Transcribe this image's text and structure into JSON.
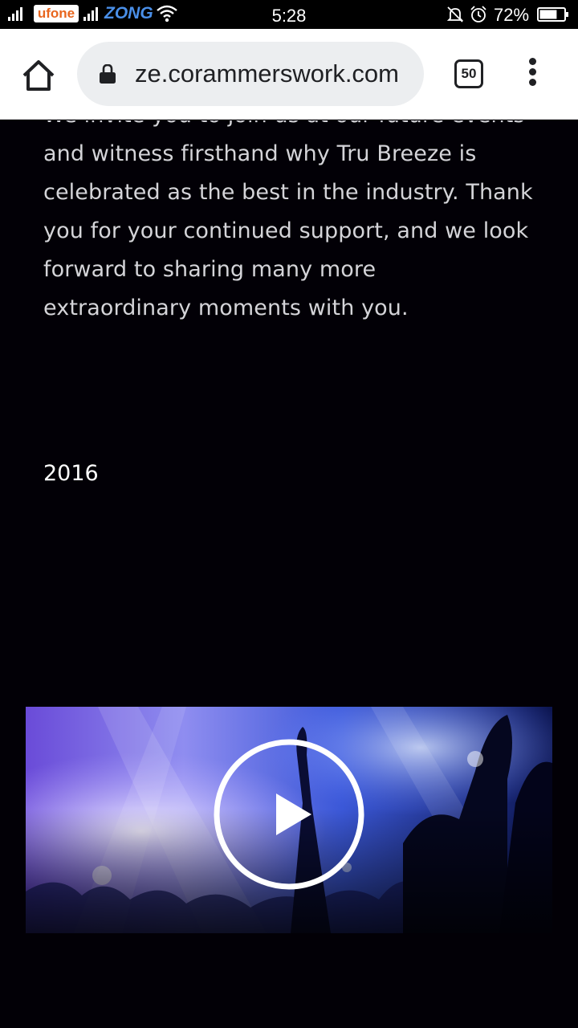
{
  "status_bar": {
    "carrier_1": "ufone",
    "carrier_2": "ZONG",
    "time": "5:28",
    "battery_percent": "72%",
    "battery_level": 0.72,
    "icons": [
      "signal-icon",
      "wifi-icon",
      "mute-icon",
      "alarm-icon",
      "battery-icon"
    ]
  },
  "browser": {
    "url": "ze.corammerswork.com",
    "tab_count": "50",
    "icons": [
      "home-icon",
      "lock-icon",
      "tabs-icon",
      "more-vert-icon"
    ]
  },
  "content": {
    "paragraph_lines": [
      "We invite you to join us at our future events",
      "and witness firsthand why Tru Breeze is",
      "celebrated as the best in the industry. Thank",
      "you for your continued support, and we look",
      "forward to sharing many more",
      "extraordinary moments with you."
    ],
    "year": "2016",
    "video": {
      "icon": "play-icon"
    }
  },
  "colors": {
    "page_background": "#020006",
    "body_text": "#d4d4d8",
    "browser_bar": "#ffffff",
    "url_box": "#eceef0"
  }
}
